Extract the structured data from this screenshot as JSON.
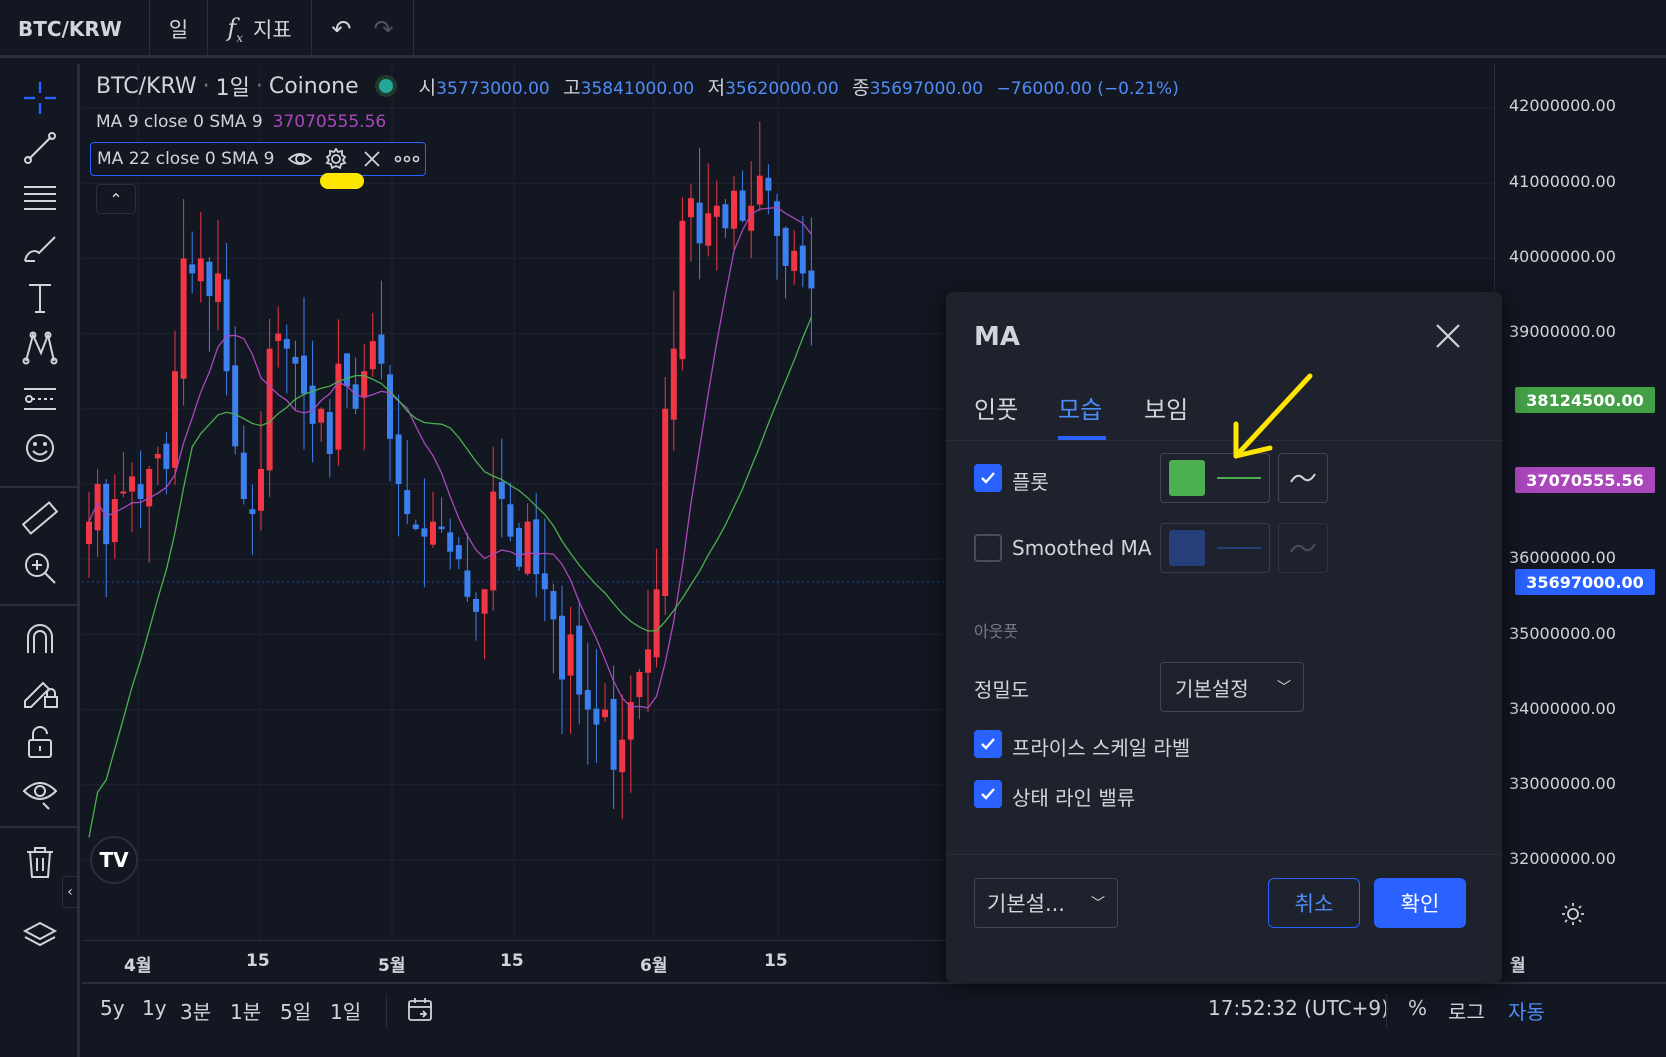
{
  "toolbar": {
    "symbol": "BTC/KRW",
    "interval": "일",
    "indicators_label": "지표",
    "fx_glyph": "f",
    "fx_sub": "x"
  },
  "legend": {
    "title": "BTC/KRW",
    "interval": "1일",
    "exchange": "Coinone",
    "sep": "·",
    "o_key": "시",
    "o_val": "35773000.00",
    "h_key": "고",
    "h_val": "35841000.00",
    "l_key": "저",
    "l_val": "35620000.00",
    "c_key": "종",
    "c_val": "35697000.00",
    "change": "−76000.00 (−0.21%)",
    "ma1": "MA 9 close 0 SMA 9",
    "ma1_value": "37070555.56",
    "ma2": "MA 22 close 0 SMA 9",
    "collapse_glyph": "⌃"
  },
  "price_axis": {
    "ticks": [
      "42000000.00",
      "41000000.00",
      "40000000.00",
      "39000000.00",
      "36000000.00",
      "35000000.00",
      "34000000.00",
      "33000000.00",
      "32000000.00"
    ],
    "label_ma22": "38124500.00",
    "label_ma9": "37070555.56",
    "label_last": "35697000.00"
  },
  "time_axis": {
    "ticks": [
      "4월",
      "15",
      "5월",
      "15",
      "6월",
      "15",
      "월"
    ]
  },
  "bottom": {
    "ranges": [
      "5y",
      "1y",
      "3분",
      "1분",
      "5일",
      "1일"
    ],
    "clock": "17:52:32 (UTC+9)",
    "percent": "%",
    "log": "로그",
    "auto": "자동"
  },
  "dialog": {
    "title": "MA",
    "tabs": [
      "인풋",
      "모습",
      "보임"
    ],
    "plot_label": "플롯",
    "smoothed_label": "Smoothed MA",
    "output_section": "아웃풋",
    "precision_label": "정밀도",
    "precision_value": "기본설정",
    "price_scale_label": "프라이스 스케일 라벨",
    "status_line_label": "상태 라인 밸류",
    "defaults_label": "기본설...",
    "cancel_label": "취소",
    "ok_label": "확인"
  },
  "colors": {
    "ma22": "#4caf50",
    "ma9": "#ab47bc",
    "up": "#f23645",
    "down": "#3c80f0",
    "accent": "#2962ff",
    "smoothed": "#2a4c9c",
    "annotation_yellow": "#ffe600"
  },
  "icons": [
    "crosshair-icon",
    "trend-line-icon",
    "fib-icon",
    "brush-icon",
    "text-icon",
    "pattern-icon",
    "prediction-icon",
    "emoji-icon",
    "ruler-icon",
    "zoom-in-icon",
    "magnet-icon",
    "lock-drawings-icon",
    "lock-icon",
    "eye-icon",
    "trash-icon",
    "layers-icon",
    "undo-icon",
    "redo-icon",
    "eye-icon",
    "gear-icon",
    "close-icon",
    "more-icon",
    "calendar-icon",
    "settings-icon",
    "checkbox-icon",
    "line-style-icon",
    "chevron-down-icon"
  ]
}
